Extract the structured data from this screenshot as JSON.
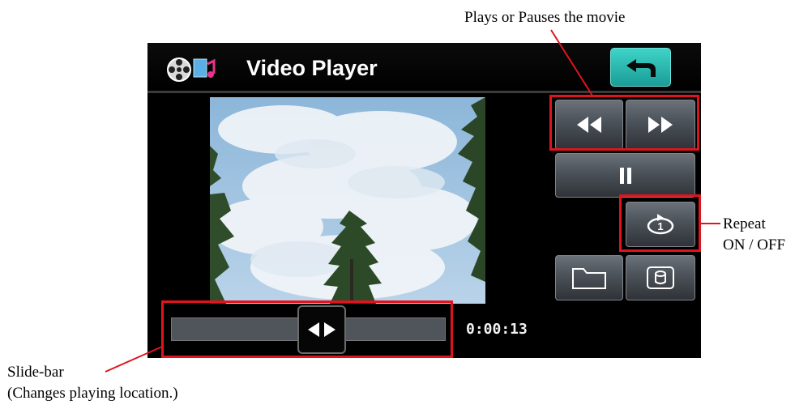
{
  "screen": {
    "title": "Video Player",
    "playback_time": "0:00:13",
    "progress_fraction": 0.55
  },
  "icons": {
    "app": "film-reel-icon",
    "back": "return-arrow-icon",
    "rewind": "rewind-icon",
    "fast_forward": "fast-forward-icon",
    "pause": "pause-icon",
    "repeat": "repeat-one-icon",
    "folder": "folder-icon",
    "storage": "storage-card-icon",
    "slider": "slider-handle-icon"
  },
  "annotations": {
    "play_pause": "Plays or Pauses the movie",
    "repeat_line1": "Repeat",
    "repeat_line2": "ON / OFF",
    "slidebar_line1": "Slide-bar",
    "slidebar_line2": "(Changes playing location.)"
  },
  "colors": {
    "highlight": "#e0141e",
    "back_button": "#2bb8b0"
  }
}
